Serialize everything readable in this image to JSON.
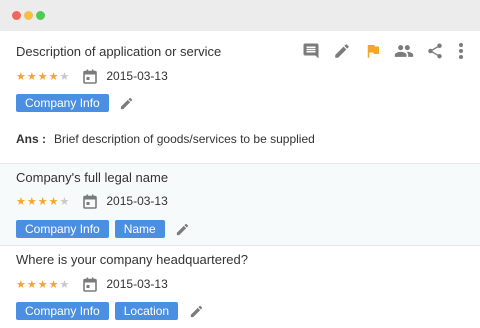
{
  "colors": {
    "accent": "#4b8fe3",
    "star": "#f4a62a",
    "flag": "#f4a62a",
    "icon_gray": "#7b7b7b"
  },
  "window_controls": [
    "close",
    "minimize",
    "maximize"
  ],
  "actions": [
    "comment-icon",
    "edit-icon",
    "flag-icon",
    "people-icon",
    "share-icon",
    "more-vert-icon"
  ],
  "questions": [
    {
      "title": "Description of application or service",
      "rating": 4,
      "rating_max": 5,
      "date": "2015-03-13",
      "tags": [
        "Company Info"
      ],
      "answer_label": "Ans :",
      "answer": "Brief description of goods/services to be supplied"
    },
    {
      "title": "Company's full legal name",
      "rating": 4,
      "rating_max": 5,
      "date": "2015-03-13",
      "tags": [
        "Company Info",
        "Name"
      ]
    },
    {
      "title": "Where is your company headquartered?",
      "rating": 4,
      "rating_max": 5,
      "date": "2015-03-13",
      "tags": [
        "Company Info",
        "Location"
      ]
    }
  ]
}
